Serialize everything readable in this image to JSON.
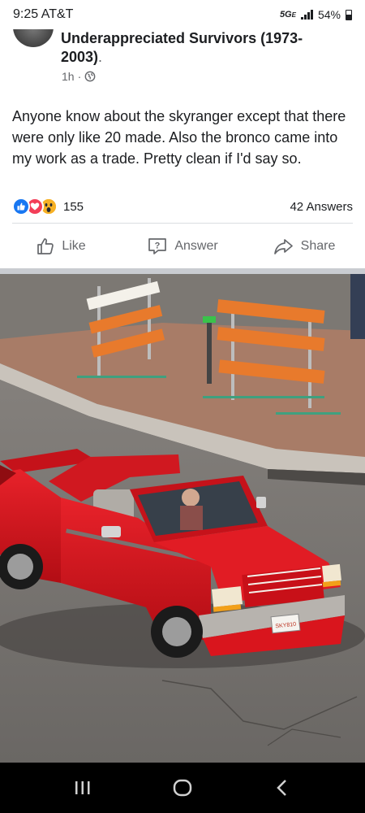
{
  "status_bar": {
    "time": "9:25",
    "carrier": "AT&T",
    "network": "5G",
    "network_suffix": "E",
    "battery": "54%",
    "battery_level": 0.54
  },
  "post": {
    "group_name": "Underappreciated Survivors (1973-2003)",
    "group_name_suffix": ".",
    "time_ago": "1h",
    "separator": "·",
    "privacy_icon": "globe-icon",
    "text": "Anyone know about the skyranger except that there were only like 20 made. Also the bronco came into my work as a trade. Pretty clean if I'd say so.",
    "reactions": {
      "icons": [
        "like-reaction-icon",
        "love-reaction-icon",
        "wow-reaction-icon"
      ],
      "count": "155"
    },
    "answers_count": "42 Answers"
  },
  "actions": {
    "like_label": "Like",
    "answer_label": "Answer",
    "share_label": "Share"
  },
  "photo": {
    "plate_text": "SKY810"
  },
  "nav": {
    "recents_icon": "recent-apps-icon",
    "home_icon": "home-icon",
    "back_icon": "back-icon"
  },
  "colors": {
    "accent": "#1877f2",
    "text": "#1c1e21",
    "secondary_text": "#65676b",
    "truck_red": "#d4131b"
  }
}
